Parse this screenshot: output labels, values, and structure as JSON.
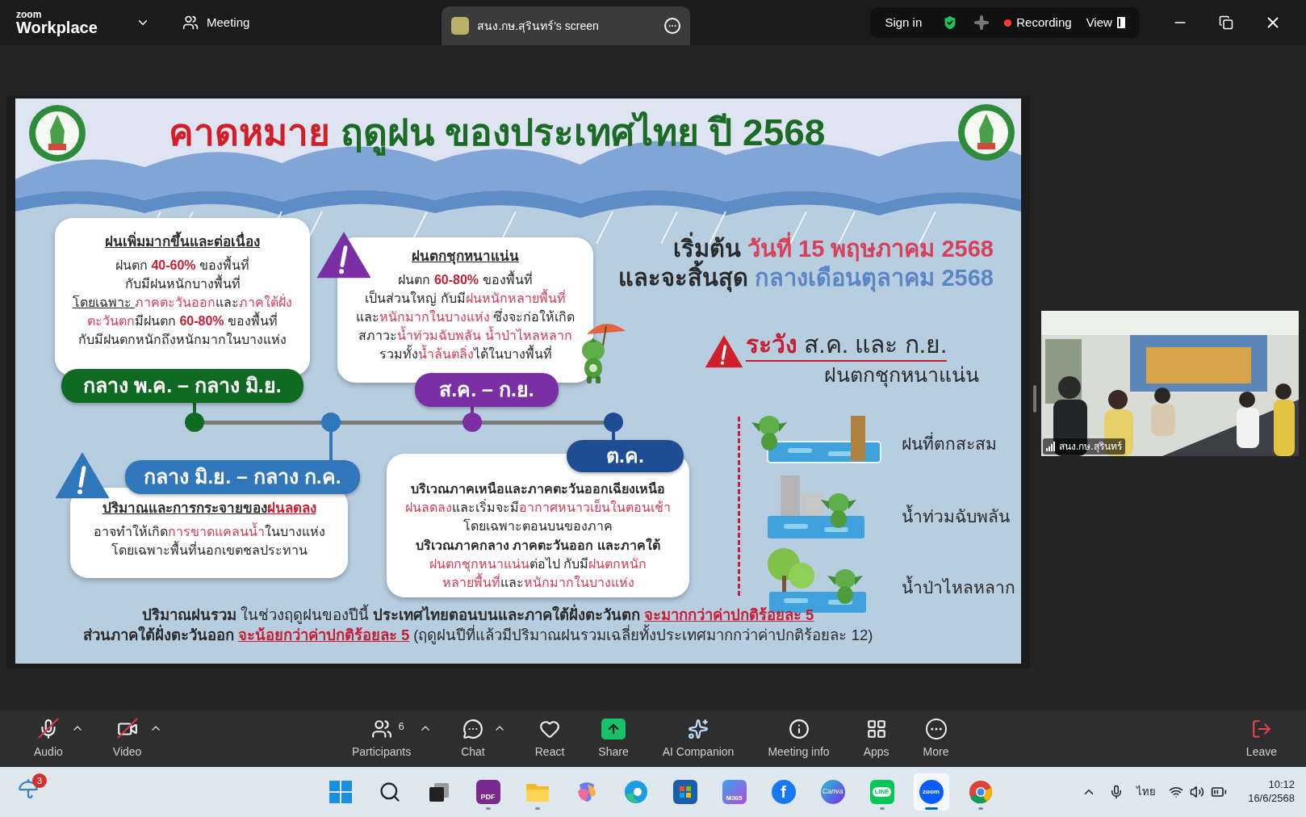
{
  "top_bar": {
    "logo_small": "zoom",
    "logo": "Workplace",
    "meeting": "Meeting",
    "share_tab": "สนง.กษ.สุรินทร์'s screen",
    "sign_in": "Sign in",
    "recording": "Recording",
    "view": "View"
  },
  "slide": {
    "title": {
      "lead": "คาดหมาย",
      "rest": "ฤดูฝน ของประเทศไทย ปี 2568"
    },
    "periods": [
      {
        "label": "กลาง พ.ค. – กลาง มิ.ย.",
        "color": "#0f6a22",
        "warning": false,
        "heading": [
          {
            "text": "ฝนเพิ่มมากขึ้นและต่อเนื่อง",
            "kind": "underline"
          }
        ],
        "lines": [
          [
            {
              "text": "ฝนตก ",
              "kind": "plain"
            },
            {
              "text": "40-60%",
              "kind": "figure"
            },
            {
              "text": " ของพื้นที่",
              "kind": "plain"
            }
          ],
          [
            {
              "text": "กับมีฝนหนักบางพื้นที่",
              "kind": "plain"
            }
          ],
          [
            {
              "text": "โดยเฉพาะ ",
              "kind": "underline"
            },
            {
              "text": "ภาคตะวันออก",
              "kind": "highlight"
            },
            {
              "text": "และ",
              "kind": "plain"
            },
            {
              "text": "ภาคใต้ฝั่ง",
              "kind": "highlight"
            }
          ],
          [
            {
              "text": "ตะวันตก",
              "kind": "highlight"
            },
            {
              "text": "มีฝนตก ",
              "kind": "plain"
            },
            {
              "text": "60-80%",
              "kind": "figure"
            },
            {
              "text": " ของพื้นที่",
              "kind": "plain"
            }
          ],
          [
            {
              "text": "กับมีฝนตกหนักถึงหนักมากในบางแห่ง",
              "kind": "plain"
            }
          ]
        ]
      },
      {
        "label": "กลาง มิ.ย. – กลาง ก.ค.",
        "color": "#2f76bb",
        "warning": true,
        "heading": [
          {
            "text": "ปริมาณและการกระจายของ",
            "kind": "underline"
          },
          {
            "text": "ฝนลดลง",
            "kind": "alert"
          }
        ],
        "lines": [
          [
            {
              "text": "อาจทำให้เกิด",
              "kind": "plain"
            },
            {
              "text": "การขาดแคลนน้ำ",
              "kind": "highlight"
            },
            {
              "text": "ในบางแห่ง",
              "kind": "plain"
            }
          ],
          [
            {
              "text": "โดยเฉพาะพื้นที่นอกเขตชลประทาน",
              "kind": "plain"
            }
          ]
        ]
      },
      {
        "label": "ส.ค. – ก.ย.",
        "color": "#7a2fa4",
        "warning": true,
        "heading": [
          {
            "text": "ฝนตกชุกหนาแน่น",
            "kind": "underline"
          }
        ],
        "lines": [
          [
            {
              "text": "ฝนตก ",
              "kind": "plain"
            },
            {
              "text": "60-80%",
              "kind": "figure"
            },
            {
              "text": " ของพื้นที่",
              "kind": "plain"
            }
          ],
          [
            {
              "text": "เป็นส่วนใหญ่ กับมี",
              "kind": "plain"
            },
            {
              "text": "ฝนหนักหลายพื้นที่",
              "kind": "highlight"
            }
          ],
          [
            {
              "text": "และ",
              "kind": "plain"
            },
            {
              "text": "หนักมากในบางแห่ง",
              "kind": "highlight"
            },
            {
              "text": " ซึ่งจะก่อให้เกิด",
              "kind": "plain"
            }
          ],
          [
            {
              "text": "สภาวะ",
              "kind": "plain"
            },
            {
              "text": "น้ำท่วมฉับพลัน น้ำป่าไหลหลาก",
              "kind": "highlight"
            }
          ],
          [
            {
              "text": "รวมทั้ง",
              "kind": "plain"
            },
            {
              "text": "น้ำล้นตลิ่ง",
              "kind": "highlight"
            },
            {
              "text": "ได้ในบางพื้นที่",
              "kind": "plain"
            }
          ]
        ]
      },
      {
        "label": "ต.ค.",
        "color": "#1e4d93",
        "warning": false,
        "lines": [
          [
            {
              "text": "บริเวณภาคเหนือและภาคตะวันออกเฉียงเหนือ",
              "kind": "bold"
            }
          ],
          [
            {
              "text": "ฝนลดลง",
              "kind": "highlight"
            },
            {
              "text": "และเริ่มจะมี",
              "kind": "plain"
            },
            {
              "text": "อากาศหนาวเย็นในตอนเช้า",
              "kind": "highlight"
            }
          ],
          [
            {
              "text": "โดยเฉพาะตอนบนของภาค",
              "kind": "plain"
            }
          ],
          [
            {
              "text": "บริเวณภาคกลาง ภาคตะวันออก และภาคใต้",
              "kind": "bold"
            }
          ],
          [
            {
              "text": "ฝนตกชุกหนาแน่น",
              "kind": "highlight"
            },
            {
              "text": "ต่อไป กับมี",
              "kind": "plain"
            },
            {
              "text": "ฝนตกหนัก",
              "kind": "highlight"
            }
          ],
          [
            {
              "text": "หลายพื้นที่",
              "kind": "highlight"
            },
            {
              "text": "และ",
              "kind": "plain"
            },
            {
              "text": "หนักมากในบางแห่ง",
              "kind": "highlight"
            }
          ]
        ]
      }
    ],
    "season": [
      [
        {
          "text": "เริ่มต้น ",
          "kind": "plain"
        },
        {
          "text": "วันที่ 15 พฤษภาคม 2568",
          "kind": "highlight"
        }
      ],
      [
        {
          "text": "และจะสิ้นสุด ",
          "kind": "plain"
        },
        {
          "text": "กลางเดือนตุลาคม 2568",
          "kind": "accent"
        }
      ]
    ],
    "caution": {
      "lead": "ระวัง",
      "months": "ส.ค. และ ก.ย.",
      "subtitle": "ฝนตกชุกหนาแน่น"
    },
    "hazards": [
      {
        "kind": "pool",
        "label": "ฝนที่ตกสะสม"
      },
      {
        "kind": "city",
        "label": "น้ำท่วมฉับพลัน"
      },
      {
        "kind": "forest",
        "label": "น้ำป่าไหลหลาก"
      }
    ],
    "summary": [
      [
        {
          "text": "ปริมาณฝนรวม",
          "kind": "bold"
        },
        {
          "text": " ในช่วงฤดูฝนของปีนี้ ",
          "kind": "plain"
        },
        {
          "text": "ประเทศไทยตอนบนและภาคใต้ฝั่งตะวันตก ",
          "kind": "bold"
        },
        {
          "text": "จะมากกว่าค่าปกติร้อยละ 5",
          "kind": "alert"
        }
      ],
      [
        {
          "text": "ส่วนภาคใต้ฝั่งตะวันออก ",
          "kind": "bold"
        },
        {
          "text": "จะน้อยกว่าค่าปกติร้อยละ 5",
          "kind": "alert"
        },
        {
          "text": " (ฤดูฝนปีที่แล้วมีปริมาณฝนรวมเฉลี่ยทั้งประเทศมากกว่าค่าปกติร้อยละ 12)",
          "kind": "plain"
        }
      ]
    ]
  },
  "video": {
    "name": "สนง.กษ.สุรินทร์"
  },
  "toolbar": [
    {
      "kind": "audio",
      "label": "Audio",
      "muted": true,
      "caret": true
    },
    {
      "kind": "video",
      "label": "Video",
      "muted": true,
      "caret": true
    },
    {
      "kind": "participants",
      "label": "Participants",
      "count": "6",
      "caret": true
    },
    {
      "kind": "chat",
      "label": "Chat",
      "caret": true
    },
    {
      "kind": "react",
      "label": "React",
      "caret": false
    },
    {
      "kind": "share",
      "label": "Share",
      "caret": false
    },
    {
      "kind": "ai",
      "label": "AI Companion",
      "caret": false
    },
    {
      "kind": "info",
      "label": "Meeting info",
      "caret": false
    },
    {
      "kind": "apps",
      "label": "Apps",
      "caret": false
    },
    {
      "kind": "more",
      "label": "More",
      "caret": false
    },
    {
      "kind": "leave",
      "label": "Leave",
      "caret": false
    }
  ],
  "taskbar": {
    "weather_badge": "3",
    "apps": [
      {
        "kind": "windows",
        "running": false,
        "selected": false
      },
      {
        "kind": "search",
        "running": false,
        "selected": false
      },
      {
        "kind": "taskview",
        "running": false,
        "selected": false
      },
      {
        "kind": "pdf",
        "glyph": "PDF",
        "running": true,
        "selected": false
      },
      {
        "kind": "folder",
        "running": true,
        "selected": false
      },
      {
        "kind": "copilot",
        "running": false,
        "selected": false
      },
      {
        "kind": "edge",
        "running": false,
        "selected": false
      },
      {
        "kind": "store",
        "running": false,
        "selected": false
      },
      {
        "kind": "m365",
        "glyph": "M365",
        "running": false,
        "selected": false
      },
      {
        "kind": "facebook",
        "glyph": "f",
        "running": false,
        "selected": false
      },
      {
        "kind": "canva",
        "glyph": "Canva",
        "running": false,
        "selected": false
      },
      {
        "kind": "line",
        "glyph": "LINE",
        "running": true,
        "selected": false
      },
      {
        "kind": "zoom",
        "glyph": "zoom",
        "running": true,
        "selected": true
      },
      {
        "kind": "chrome",
        "running": true,
        "selected": false
      }
    ],
    "language": "ไทย",
    "time": "10:12",
    "date": "16/6/2568"
  }
}
